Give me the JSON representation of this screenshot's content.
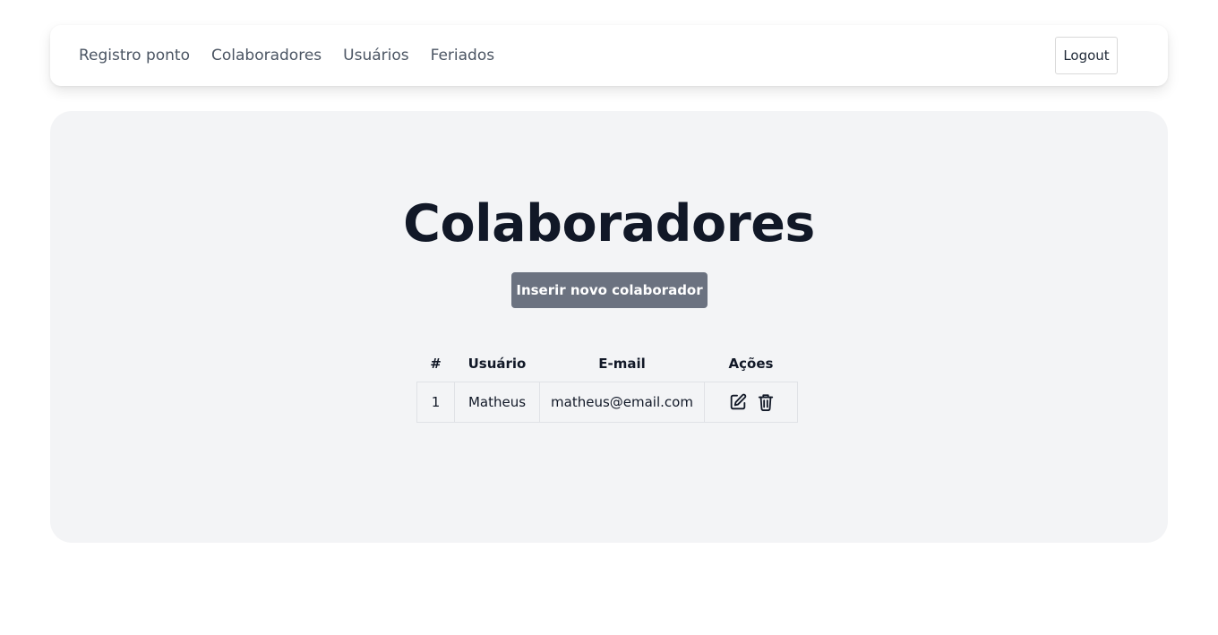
{
  "nav": {
    "items": [
      {
        "label": "Registro ponto"
      },
      {
        "label": "Colaboradores"
      },
      {
        "label": "Usuários"
      },
      {
        "label": "Feriados"
      }
    ],
    "logout_label": "Logout"
  },
  "main": {
    "title": "Colaboradores",
    "insert_label": "Inserir novo colaborador",
    "table": {
      "headers": [
        "#",
        "Usuário",
        "E-mail",
        "Ações"
      ],
      "rows": [
        {
          "id": "1",
          "user": "Matheus",
          "email": "matheus@email.com",
          "actions": [
            "edit-icon",
            "trash-icon"
          ]
        }
      ]
    }
  },
  "colors": {
    "title": "#111827",
    "nav_text": "#4b5563",
    "panel_bg": "#f3f4f6",
    "primary_button": "#6b7280"
  }
}
